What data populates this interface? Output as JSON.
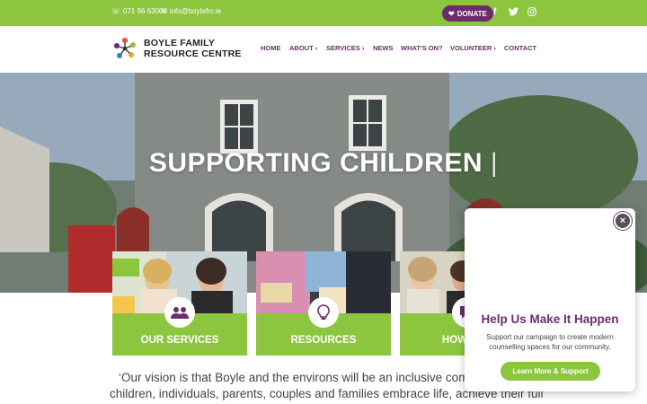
{
  "topbar": {
    "phone_icon": "phone-icon",
    "phone": "071 96 63000",
    "email_icon": "email-icon",
    "email": "info@boylefrc.ie",
    "donate_label": "DONATE",
    "donate_icon": "heart-icon",
    "social": [
      "facebook-icon",
      "twitter-icon",
      "instagram-icon"
    ]
  },
  "brand": {
    "line1": "BOYLE FAMILY",
    "line2": "RESOURCE CENTRE"
  },
  "nav": {
    "home": "HOME",
    "about": "ABOUT ›",
    "services": "SERVICES ›",
    "news": "NEWS",
    "whats_on": "WHAT'S ON?",
    "volunteer": "VOLUNTEER ›",
    "contact": "CONTACT"
  },
  "hero": {
    "title": "SUPPORTING CHILDREN",
    "caret": "|"
  },
  "cards": [
    {
      "label": "OUR SERVICES",
      "icon": "people-icon"
    },
    {
      "label": "RESOURCES",
      "icon": "lightbulb-icon"
    },
    {
      "label": "HOW CAN",
      "icon": "chat-icon"
    }
  ],
  "vision": {
    "line1": "‘Our vision is that Boyle and the environs will be an inclusive comm",
    "line2": "children, individuals, parents, couples and families embrace life, achieve their full"
  },
  "popup": {
    "title": "Help Us Make It Happen",
    "text": "Support our campaign to create modern counselling spaces for our community.",
    "button": "Learn More & Support",
    "close": "×"
  },
  "colors": {
    "green": "#8cc63f",
    "purple": "#6b2d6e"
  }
}
